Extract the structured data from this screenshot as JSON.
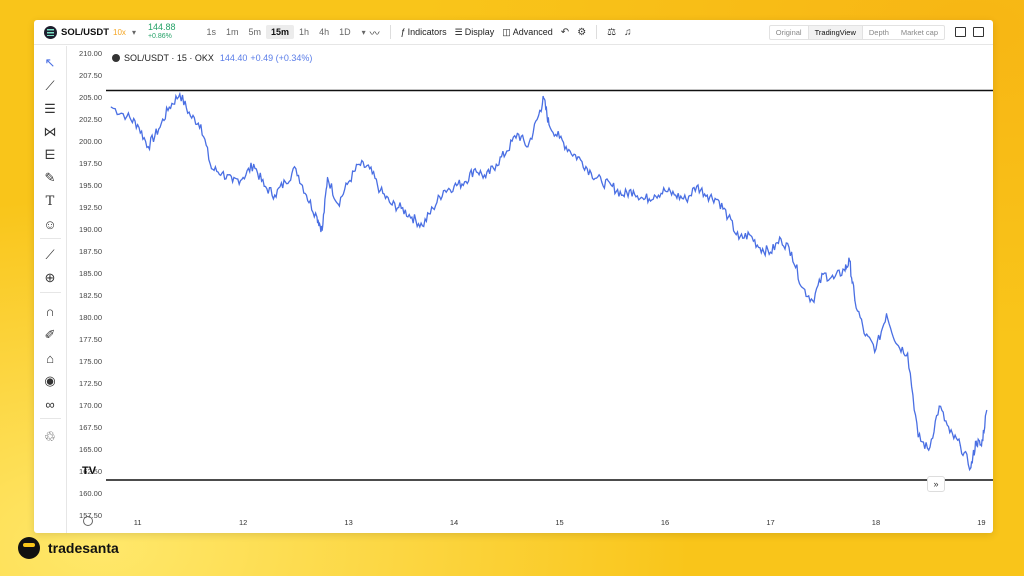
{
  "topbar": {
    "symbol": "SOL/USDT",
    "leverage": "10x",
    "price": "144.88",
    "change": "+0.86%",
    "timeframes": [
      "1s",
      "1m",
      "5m",
      "15m",
      "1h",
      "4h",
      "1D"
    ],
    "active_timeframe": "15m",
    "indicators_label": "Indicators",
    "display_label": "Display",
    "advanced_label": "Advanced",
    "views": [
      "Original",
      "TradingView",
      "Depth",
      "Market cap"
    ],
    "active_view": "TradingView"
  },
  "legend": {
    "name": "SOL/USDT · 15 · OKX",
    "value": "144.40",
    "change": "+0.49 (+0.34%)"
  },
  "left_toolbar": {
    "icons": [
      "cursor-icon",
      "trend-line-icon",
      "fib-retracement-icon",
      "pattern-icon",
      "prediction-icon",
      "brush-icon",
      "text-icon",
      "emoji-icon",
      "ruler-icon",
      "zoom-in-icon",
      "magnet-icon",
      "lock-drawings-pen-icon",
      "lock-icon",
      "eye-icon",
      "link-icon",
      "trash-icon"
    ]
  },
  "brand": {
    "name": "tradesanta"
  },
  "colors": {
    "line": "#4a6fe3",
    "background": "#f9c51a",
    "up": "#26a269"
  },
  "chart_data": {
    "type": "line",
    "title": "",
    "xlabel": "",
    "ylabel": "",
    "x_ticks": [
      "11",
      "12",
      "13",
      "14",
      "15",
      "16",
      "17",
      "18",
      "19"
    ],
    "y_ticks": [
      "210.00",
      "207.50",
      "205.00",
      "202.50",
      "200.00",
      "197.50",
      "195.00",
      "192.50",
      "190.00",
      "187.50",
      "185.00",
      "182.50",
      "180.00",
      "177.50",
      "175.00",
      "172.50",
      "170.00",
      "167.50",
      "165.00",
      "162.50",
      "160.00",
      "157.50"
    ],
    "ylim": [
      157.5,
      210.5
    ],
    "xlim": [
      10.7,
      19.1
    ],
    "horizontal_lines": [
      205.9,
      161.6
    ],
    "series": [
      {
        "x": [
          10.75,
          10.9,
          11.0,
          11.1,
          11.2,
          11.3,
          11.4,
          11.5,
          11.6,
          11.7,
          11.8,
          11.9,
          12.0,
          12.1,
          12.2,
          12.3,
          12.4,
          12.5,
          12.6,
          12.7,
          12.75,
          12.8,
          12.9,
          13.0,
          13.1,
          13.2,
          13.3,
          13.4,
          13.5,
          13.6,
          13.7,
          13.8,
          13.9,
          14.0,
          14.1,
          14.2,
          14.3,
          14.4,
          14.5,
          14.6,
          14.7,
          14.8,
          14.85,
          14.9,
          15.0,
          15.1,
          15.2,
          15.3,
          15.4,
          15.5,
          15.6,
          15.7,
          15.8,
          15.9,
          16.0,
          16.1,
          16.2,
          16.3,
          16.4,
          16.5,
          16.6,
          16.7,
          16.8,
          16.9,
          17.0,
          17.1,
          17.2,
          17.3,
          17.4,
          17.5,
          17.6,
          17.7,
          17.75,
          17.8,
          17.9,
          18.0,
          18.1,
          18.2,
          18.3,
          18.4,
          18.5,
          18.6,
          18.7,
          18.8,
          18.9,
          18.95,
          19.0,
          19.05
        ],
        "y": [
          204.0,
          203.0,
          202.0,
          199.5,
          201.5,
          204.0,
          205.5,
          203.0,
          202.0,
          197.0,
          196.5,
          195.5,
          196.0,
          197.5,
          195.0,
          194.0,
          195.5,
          197.0,
          194.0,
          191.5,
          190.0,
          196.0,
          193.0,
          195.5,
          197.5,
          197.0,
          194.5,
          193.0,
          192.5,
          191.5,
          190.5,
          192.5,
          194.5,
          195.0,
          195.5,
          197.0,
          196.0,
          197.5,
          199.0,
          201.0,
          199.5,
          203.0,
          205.0,
          202.0,
          200.5,
          199.0,
          198.0,
          196.5,
          195.5,
          195.0,
          194.0,
          194.5,
          193.5,
          194.0,
          194.5,
          194.0,
          193.5,
          195.0,
          194.0,
          193.5,
          191.5,
          189.0,
          189.5,
          188.0,
          187.5,
          189.0,
          187.5,
          183.5,
          182.0,
          185.0,
          184.5,
          185.5,
          186.5,
          182.0,
          178.0,
          176.5,
          180.5,
          177.0,
          176.0,
          166.5,
          165.0,
          170.0,
          167.0,
          165.5,
          163.0,
          166.0,
          165.5,
          169.5
        ]
      }
    ]
  }
}
